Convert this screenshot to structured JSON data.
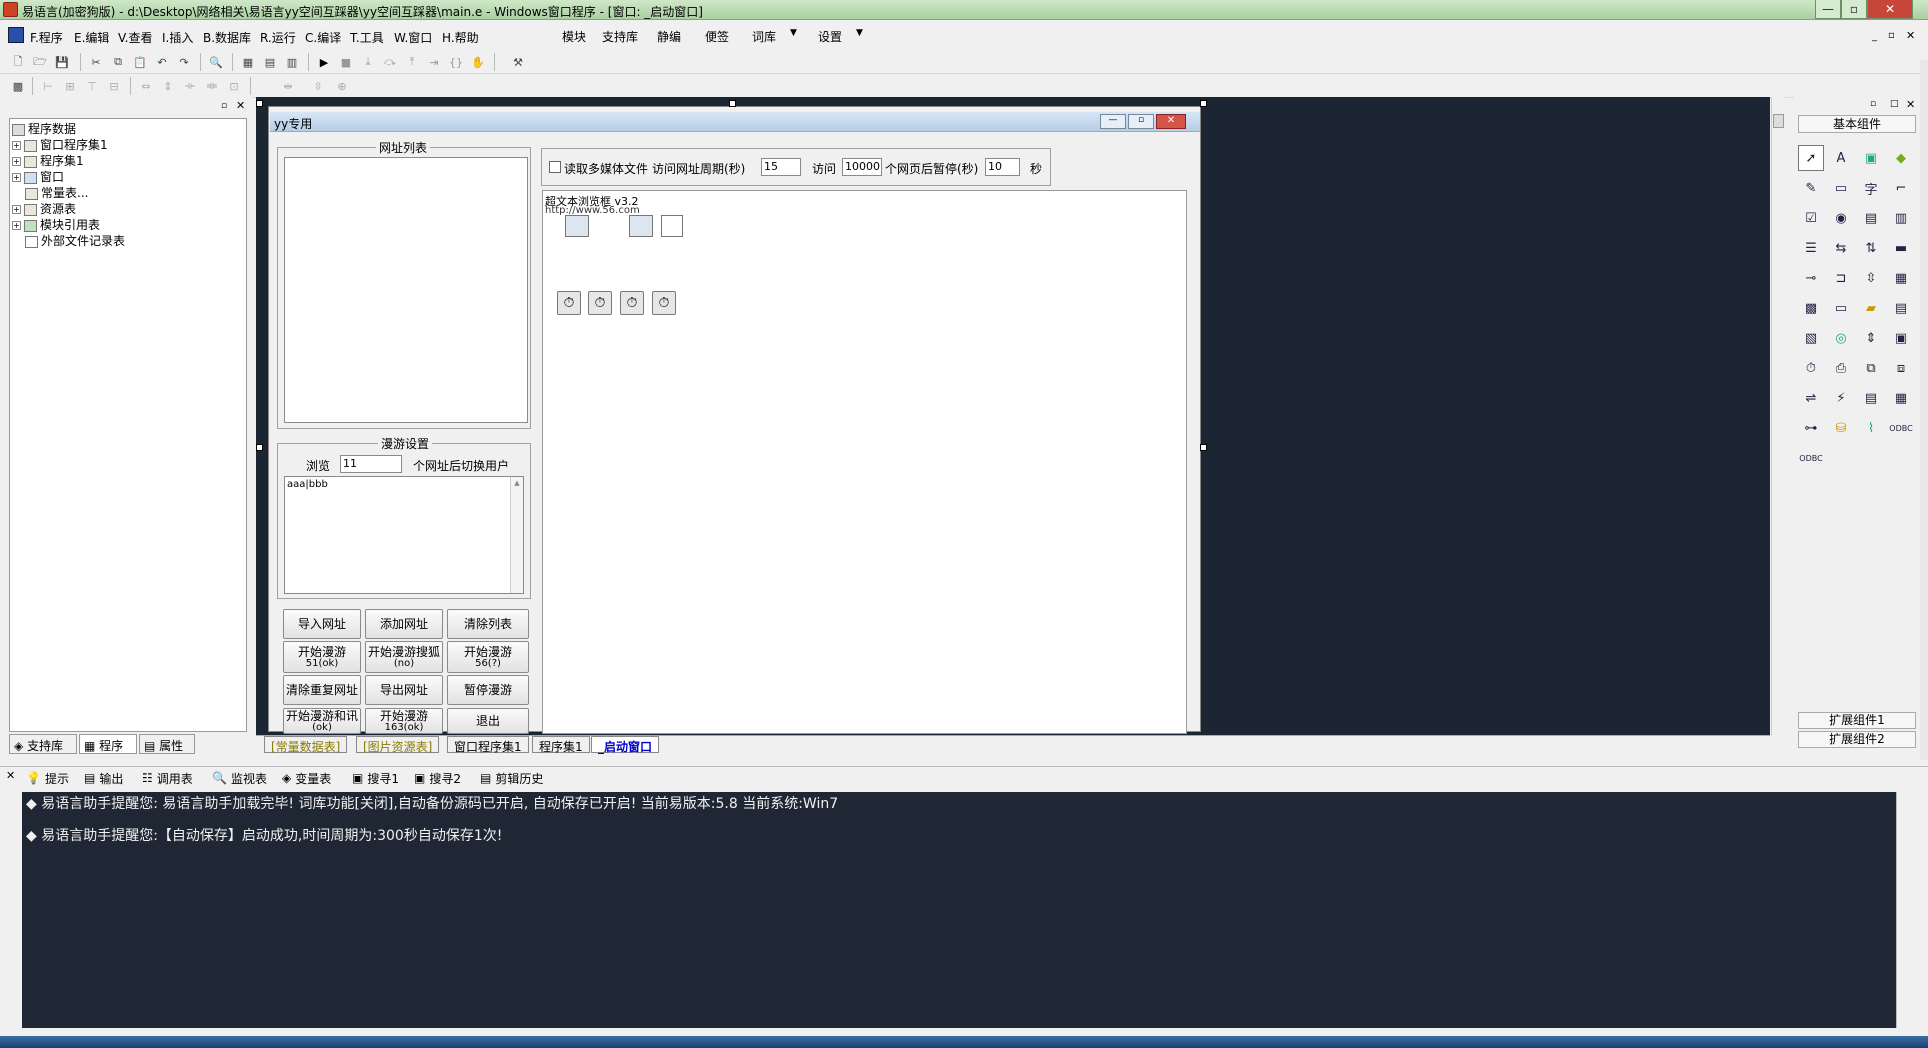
{
  "window": {
    "title": "易语言(加密狗版) - d:\\Desktop\\网络相关\\易语言yy空间互踩器\\yy空间互踩器\\main.e - Windows窗口程序 - [窗口: _启动窗口]",
    "minimize": "—",
    "restore": "▫",
    "close": "✕"
  },
  "menubar": {
    "items": [
      {
        "key": "F",
        "label": "F.程序"
      },
      {
        "key": "E",
        "label": "E.编辑"
      },
      {
        "key": "V",
        "label": "V.查看"
      },
      {
        "key": "I",
        "label": "I.插入"
      },
      {
        "key": "B",
        "label": "B.数据库"
      },
      {
        "key": "R",
        "label": "R.运行"
      },
      {
        "key": "C",
        "label": "C.编译"
      },
      {
        "key": "T",
        "label": "T.工具"
      },
      {
        "key": "W",
        "label": "W.窗口"
      },
      {
        "key": "H",
        "label": "H.帮助"
      }
    ],
    "extra": [
      "模块",
      "支持库",
      "静编",
      "便签",
      "词库",
      "设置"
    ],
    "dropdown_arrow": "▼"
  },
  "tree": {
    "root": "程序数据",
    "items": [
      "窗口程序集1",
      "程序集1",
      "窗口",
      "常量表...",
      "资源表",
      "模块引用表",
      "外部文件记录表"
    ],
    "panel_tabs": [
      "支持库",
      "程序",
      "属性"
    ]
  },
  "form": {
    "title": "yy专用",
    "url_group": "网址列表",
    "read_media_label": "读取多媒体文件",
    "visit_period_label": "访问网址周期(秒)",
    "visit_period_value": "15",
    "visit_label": "访问",
    "visit_value": "10000",
    "pause_label": "个网页后暂停(秒)",
    "pause_value": "10",
    "sec_label": "秒",
    "browser_text": "超文本浏览框 v3.2",
    "browser_url": "http://www.56.com",
    "roam_group": "漫游设置",
    "browse_label": "浏览",
    "browse_value": "11",
    "switch_label": "个网址后切换用户",
    "roam_text": "aaa|bbb",
    "buttons": [
      {
        "label": "导入网址",
        "sub": ""
      },
      {
        "label": "添加网址",
        "sub": ""
      },
      {
        "label": "清除列表",
        "sub": ""
      },
      {
        "label": "开始漫游",
        "sub": "51(ok)"
      },
      {
        "label": "开始漫游搜狐",
        "sub": "(no)"
      },
      {
        "label": "开始漫游",
        "sub": "56(?)"
      },
      {
        "label": "清除重复网址",
        "sub": ""
      },
      {
        "label": "导出网址",
        "sub": ""
      },
      {
        "label": "暂停漫游",
        "sub": ""
      },
      {
        "label": "开始漫游和讯",
        "sub": "(ok)"
      },
      {
        "label": "开始漫游",
        "sub": "163(ok)"
      },
      {
        "label": "退出",
        "sub": ""
      }
    ]
  },
  "bottom_tabs": [
    "[常量数据表]",
    "[图片资源表]",
    "窗口程序集1",
    "程序集1",
    "_启动窗口"
  ],
  "palette": {
    "header": "基本组件",
    "ext1": "扩展组件1",
    "ext2": "扩展组件2"
  },
  "output_tabs": [
    "提示",
    "输出",
    "调用表",
    "监视表",
    "变量表",
    "搜寻1",
    "搜寻2",
    "剪辑历史"
  ],
  "output_lines": [
    "◆ 易语言助手提醒您:  易语言助手加载完毕!  词库功能[关闭],自动备份源码已开启, 自动保存已开启!  当前易版本:5.8  当前系统:Win7",
    "◆ 易语言助手提醒您:【自动保存】启动成功,时间周期为:300秒自动保存1次!"
  ],
  "colors": {
    "design_bg": "#1c2532",
    "output_bg": "#1e2733",
    "active_tab": "#0000cc"
  }
}
